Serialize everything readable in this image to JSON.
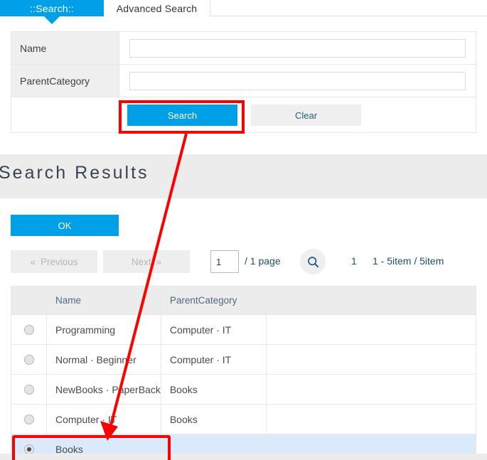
{
  "theme": {
    "accent": "#00a0e9",
    "annotation": "#ff0000",
    "selected_row": "#dbeafa",
    "band_gray": "#ececec"
  },
  "tabs": [
    {
      "label": "::Search::",
      "active": true
    },
    {
      "label": "Advanced Search",
      "active": false
    }
  ],
  "search_form": {
    "rows": [
      {
        "label": "Name",
        "value": "",
        "placeholder": ""
      },
      {
        "label": "ParentCategory",
        "value": "",
        "placeholder": ""
      }
    ],
    "search_button": "Search",
    "clear_button": "Clear"
  },
  "results": {
    "title": "Search Results",
    "ok_button": "OK",
    "pager": {
      "previous": "Previous",
      "previous_chevron": "«",
      "next": "Next",
      "next_chevron": "»",
      "page_input_value": "1",
      "page_total_label": "/  1 page",
      "magnifier_icon": "search-icon",
      "current_page": "1",
      "range_label": "1 - 5item / 5item"
    },
    "grid": {
      "columns": [
        "",
        "Name",
        "ParentCategory",
        ""
      ],
      "rows": [
        {
          "selected": false,
          "name": "Programming",
          "parent_category": "Computer · IT"
        },
        {
          "selected": false,
          "name": "Normal · Beginner",
          "parent_category": "Computer · IT"
        },
        {
          "selected": false,
          "name": "NewBooks · PaperBack",
          "parent_category": "Books"
        },
        {
          "selected": false,
          "name": "Computer · IT",
          "parent_category": "Books"
        },
        {
          "selected": true,
          "name": "Books",
          "parent_category": ""
        }
      ]
    }
  }
}
